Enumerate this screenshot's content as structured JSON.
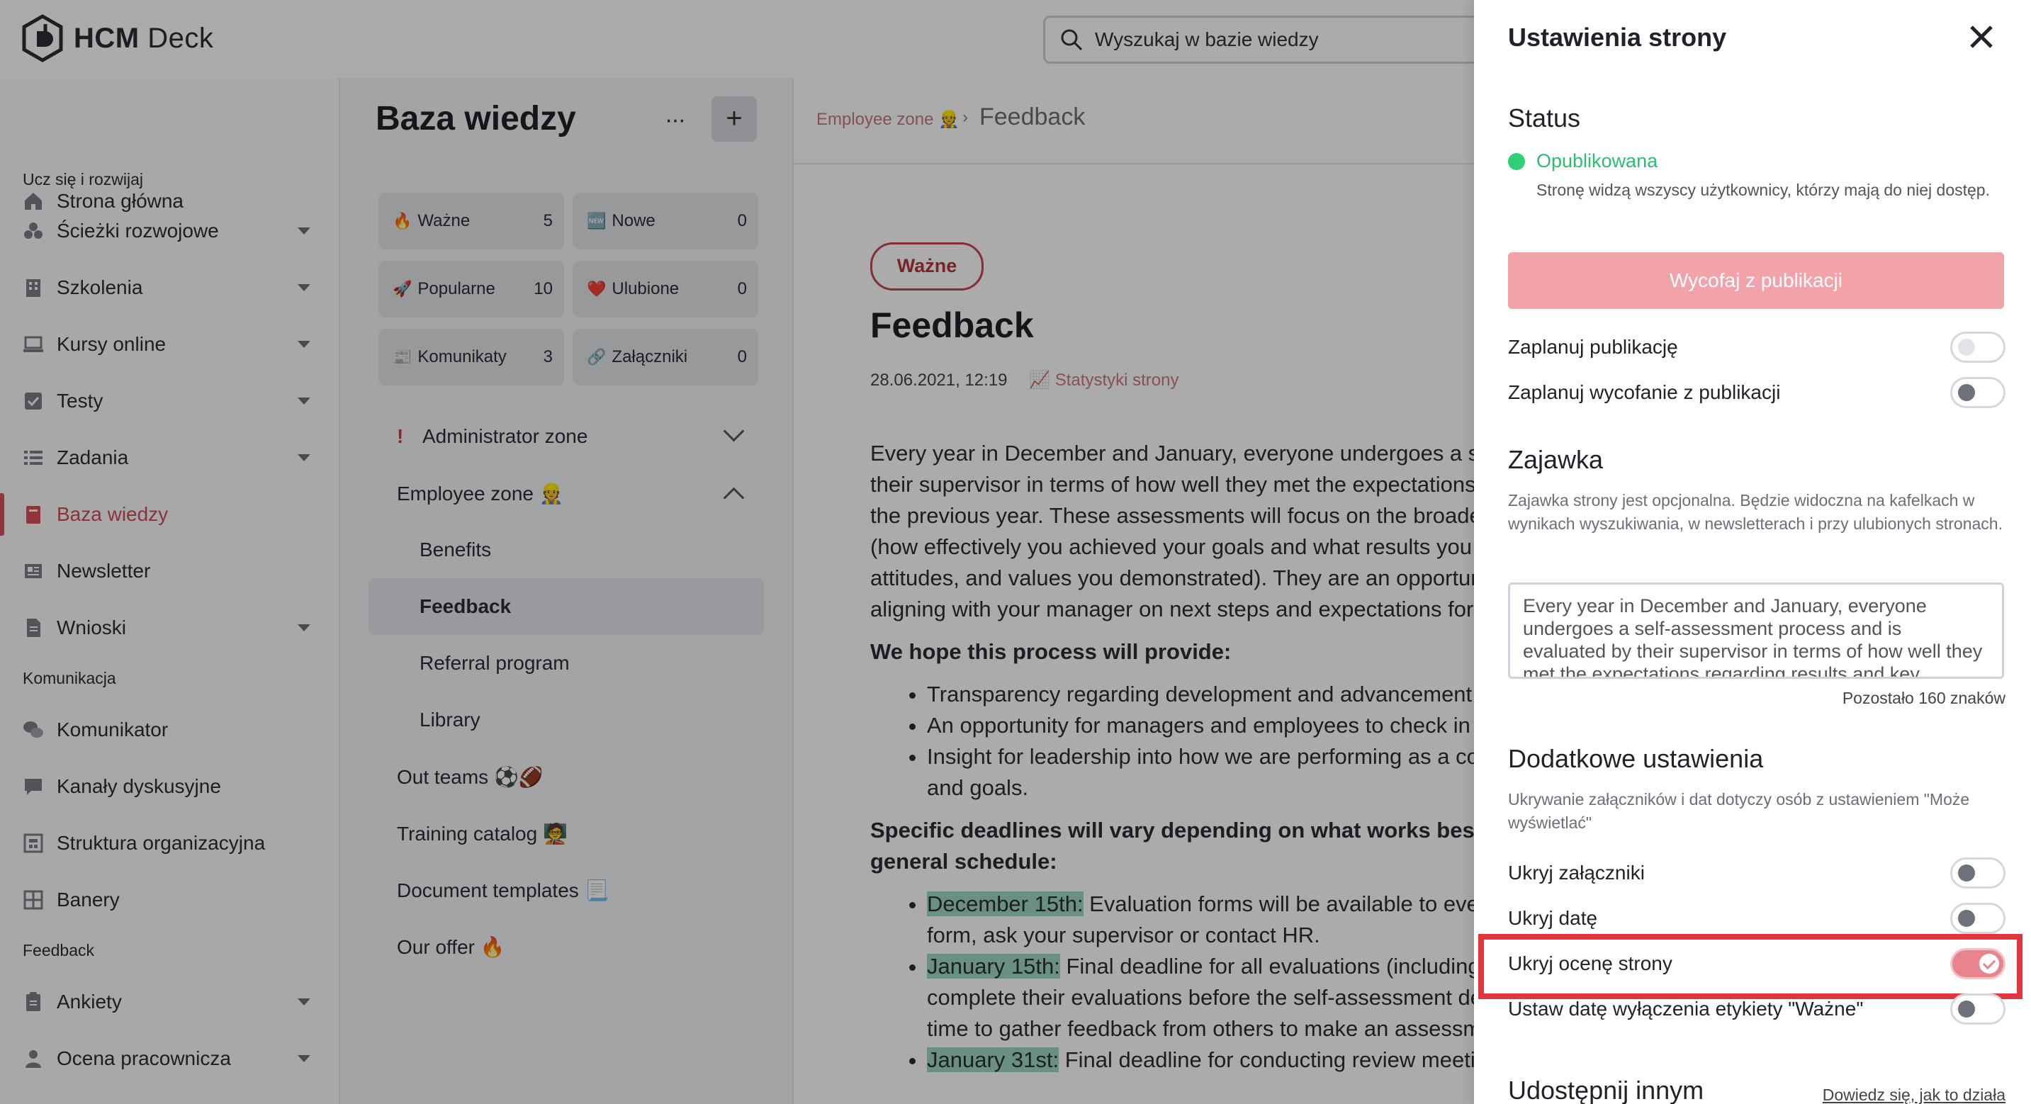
{
  "app": {
    "name_bold": "HCM",
    "name_rest": " Deck"
  },
  "search": {
    "placeholder": "Wyszukaj w bazie wiedzy"
  },
  "sidebar": {
    "home": "Strona główna",
    "section_learn": "Ucz się i rozwijaj",
    "paths": "Ścieżki rozwojowe",
    "trainings": "Szkolenia",
    "courses": "Kursy online",
    "tests": "Testy",
    "tasks": "Zadania",
    "kb": "Baza wiedzy",
    "newsletter": "Newsletter",
    "requests": "Wnioski",
    "section_comm": "Komunikacja",
    "messenger": "Komunikator",
    "channels": "Kanały dyskusyjne",
    "org": "Struktura organizacyjna",
    "banners": "Banery",
    "section_feedback": "Feedback",
    "surveys": "Ankiety",
    "review": "Ocena pracownicza"
  },
  "kb": {
    "title": "Baza wiedzy",
    "more": "···",
    "add": "+",
    "tiles": [
      {
        "icon": "🔥",
        "label": "Ważne",
        "count": "5"
      },
      {
        "icon": "🆕",
        "label": "Nowe",
        "count": "0"
      },
      {
        "icon": "🚀",
        "label": "Popularne",
        "count": "10"
      },
      {
        "icon": "❤️",
        "label": "Ulubione",
        "count": "0"
      },
      {
        "icon": "📰",
        "label": "Komunikaty",
        "count": "3"
      },
      {
        "icon": "🔗",
        "label": "Załączniki",
        "count": "0"
      }
    ],
    "tree": {
      "admin_mark": "!",
      "admin": "Administrator zone",
      "employee": "Employee zone 👷",
      "benefits": "Benefits",
      "feedback": "Feedback",
      "referral": "Referral program",
      "library": "Library",
      "teams": "Out teams ⚽🏈",
      "training": "Training catalog 🧑‍🏫",
      "templates": "Document templates 📃",
      "offer": "Our offer 🔥"
    }
  },
  "article": {
    "crumb_parent": "Employee zone 👷",
    "crumb_sep": "›",
    "crumb_current": "Feedback",
    "badge": "Ważne",
    "title": "Feedback",
    "date": "28.06.2021, 12:19",
    "stats": "Statystyki strony",
    "p1": [
      "Every year in December and January, everyone undergoes a self-assessment process and is evaluated by",
      "their supervisor in terms of how well they met the expectations regarding results and key behaviors over",
      "the previous year. These assessments will focus on the broader context",
      "(how effectively you achieved your goals and what results you delivered as well as the",
      "attitudes, and values you demonstrated). They are an opportunity for",
      "aligning with your manager on next steps and expectations for the coming year."
    ],
    "h_hope": "We hope this process will provide:",
    "bullets1": [
      "Transparency regarding development and advancement",
      "An opportunity for managers and employees to check in",
      "Insight for leadership into how we are performing as a company"
    ],
    "bullet1_cont": "and goals.",
    "h_deadlines_1": "Specific deadlines will vary depending on what works best for your team, but here is the",
    "h_deadlines_2": "general schedule:",
    "d1_date": "December 15th:",
    "d1_text": " Evaluation forms will be available to everyone. If you do not receive the",
    "d1_cont": "form, ask your supervisor or contact HR.",
    "d2_date": "January 15th:",
    "d2_text": " Final deadline for all evaluations (including self-assessments). Supervisors",
    "d2_cont1": "complete their evaluations before the self-assessment deadline to give employees",
    "d2_cont2": "time to gather feedback from others to make an assessment.",
    "d3_date": "January 31st:",
    "d3_text": " Final deadline for conducting review meetings."
  },
  "drawer": {
    "title": "Ustawienia strony",
    "status_h": "Status",
    "status_value": "Opublikowana",
    "status_desc": "Stronę widzą wszyscy użytkownicy, którzy mają do niej dostęp.",
    "unpublish": "Wycofaj z publikacji",
    "schedule_pub": "Zaplanuj publikację",
    "schedule_unpub": "Zaplanuj wycofanie z publikacji",
    "teaser_h": "Zajawka",
    "teaser_hint": "Zajawka strony jest opcjonalna. Będzie widoczna na kafelkach w wynikach wyszukiwania, w newsletterach i przy ulubionych stronach.",
    "teaser_value": "Every year in December and January, everyone undergoes a self-assessment process and is evaluated by their supervisor in terms of how well they met the expectations regarding results and key behaviors",
    "remaining": "Pozostało 160 znaków",
    "extra_h": "Dodatkowe ustawienia",
    "extra_hint": "Ukrywanie załączników i dat dotyczy osób z ustawieniem \"Może wyświetlać\"",
    "hide_attach": "Ukryj załączniki",
    "hide_date": "Ukryj datę",
    "hide_rating": "Ukryj ocenę strony",
    "important_date": "Ustaw datę wyłączenia etykiety \"Ważne\"",
    "share_h": "Udostępnij innym",
    "learn": "Dowiedz się, jak to działa",
    "toggles": {
      "schedule_pub": false,
      "schedule_unpub": false,
      "hide_attach": false,
      "hide_date": false,
      "hide_rating": true,
      "important_date": false
    },
    "accent": "#e7848d"
  },
  "colors": {
    "brand_red": "#d9505b",
    "published_green": "#2fcf78",
    "highlight": "#9fd6c3",
    "callout": "#e2363c"
  }
}
